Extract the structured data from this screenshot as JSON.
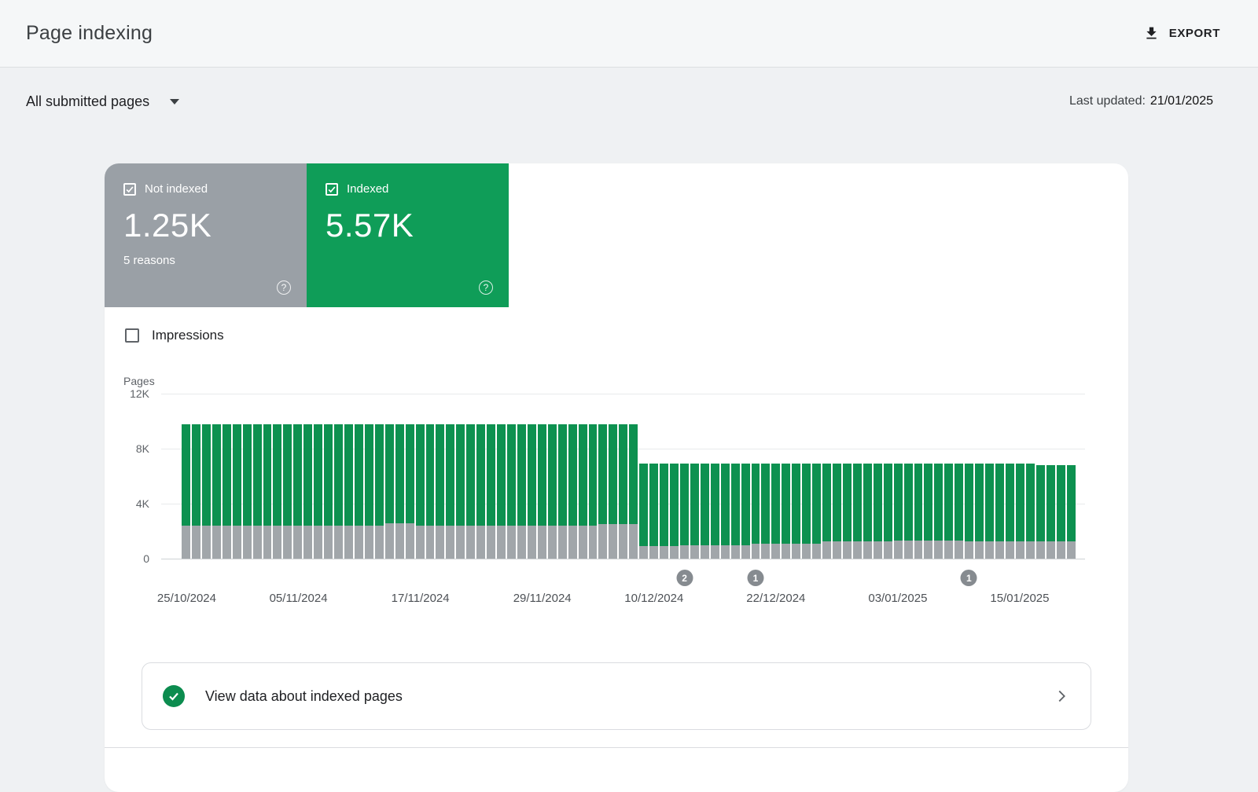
{
  "header": {
    "title": "Page indexing",
    "export_label": "EXPORT"
  },
  "filter_bar": {
    "dropdown_label": "All submitted pages",
    "last_updated_label": "Last updated:",
    "last_updated_value": "21/01/2025"
  },
  "summary_cards": [
    {
      "label": "Not indexed",
      "value": "1.25K",
      "sub": "5 reasons",
      "checked": true,
      "color": "#9aa0a6"
    },
    {
      "label": "Indexed",
      "value": "5.57K",
      "sub": "",
      "checked": true,
      "color": "#0f9d58"
    }
  ],
  "impressions_checkbox": {
    "label": "Impressions",
    "checked": false
  },
  "icons": {
    "help": "?"
  },
  "view_data_row": {
    "label": "View data about indexed pages"
  },
  "chart_data": {
    "type": "bar",
    "stacked": true,
    "title": "",
    "xlabel": "",
    "ylabel": "Pages",
    "ylim": [
      0,
      12000
    ],
    "grid": true,
    "num_bars": 88,
    "date_range": [
      "25/10/2024",
      "20/01/2025"
    ],
    "yticks": [
      {
        "label": "12K",
        "value": 12000
      },
      {
        "label": "8K",
        "value": 8000
      },
      {
        "label": "4K",
        "value": 4000
      },
      {
        "label": "0",
        "value": 0
      }
    ],
    "x_ticks": [
      {
        "label": "25/10/2024",
        "index": 0
      },
      {
        "label": "05/11/2024",
        "index": 11
      },
      {
        "label": "17/11/2024",
        "index": 23
      },
      {
        "label": "29/11/2024",
        "index": 35
      },
      {
        "label": "10/12/2024",
        "index": 46
      },
      {
        "label": "22/12/2024",
        "index": 58
      },
      {
        "label": "03/01/2025",
        "index": 70
      },
      {
        "label": "15/01/2025",
        "index": 82
      }
    ],
    "markers": [
      {
        "label": "2",
        "index": 49
      },
      {
        "label": "1",
        "index": 56
      },
      {
        "label": "1",
        "index": 77
      }
    ],
    "series": [
      {
        "name": "Not indexed",
        "color": "#a1a6aa",
        "values": [
          2400,
          2400,
          2400,
          2400,
          2400,
          2400,
          2400,
          2400,
          2400,
          2400,
          2400,
          2400,
          2400,
          2400,
          2400,
          2400,
          2400,
          2400,
          2400,
          2400,
          2600,
          2600,
          2600,
          2400,
          2400,
          2400,
          2400,
          2400,
          2400,
          2400,
          2400,
          2400,
          2400,
          2400,
          2400,
          2400,
          2400,
          2400,
          2400,
          2400,
          2400,
          2500,
          2500,
          2500,
          2500,
          900,
          900,
          900,
          900,
          1000,
          1000,
          1000,
          1000,
          1000,
          1000,
          1000,
          1100,
          1100,
          1100,
          1100,
          1100,
          1100,
          1100,
          1250,
          1250,
          1250,
          1250,
          1250,
          1250,
          1250,
          1300,
          1300,
          1300,
          1300,
          1300,
          1300,
          1300,
          1250,
          1250,
          1250,
          1250,
          1250,
          1250,
          1250,
          1250,
          1250,
          1250,
          1250
        ]
      },
      {
        "name": "Indexed",
        "color": "#0d9150",
        "values": [
          7400,
          7400,
          7400,
          7400,
          7400,
          7400,
          7400,
          7400,
          7400,
          7400,
          7400,
          7400,
          7400,
          7400,
          7400,
          7400,
          7400,
          7400,
          7400,
          7400,
          7200,
          7200,
          7200,
          7400,
          7400,
          7400,
          7400,
          7400,
          7400,
          7400,
          7400,
          7400,
          7400,
          7400,
          7400,
          7400,
          7400,
          7400,
          7400,
          7400,
          7400,
          7300,
          7300,
          7300,
          7300,
          6000,
          6000,
          6000,
          6000,
          5900,
          5900,
          5900,
          5900,
          5900,
          5900,
          5900,
          5800,
          5800,
          5800,
          5800,
          5800,
          5800,
          5800,
          5650,
          5650,
          5650,
          5650,
          5650,
          5650,
          5650,
          5600,
          5600,
          5600,
          5600,
          5600,
          5600,
          5600,
          5650,
          5650,
          5650,
          5650,
          5650,
          5650,
          5650,
          5570,
          5570,
          5570,
          5570
        ]
      }
    ]
  }
}
